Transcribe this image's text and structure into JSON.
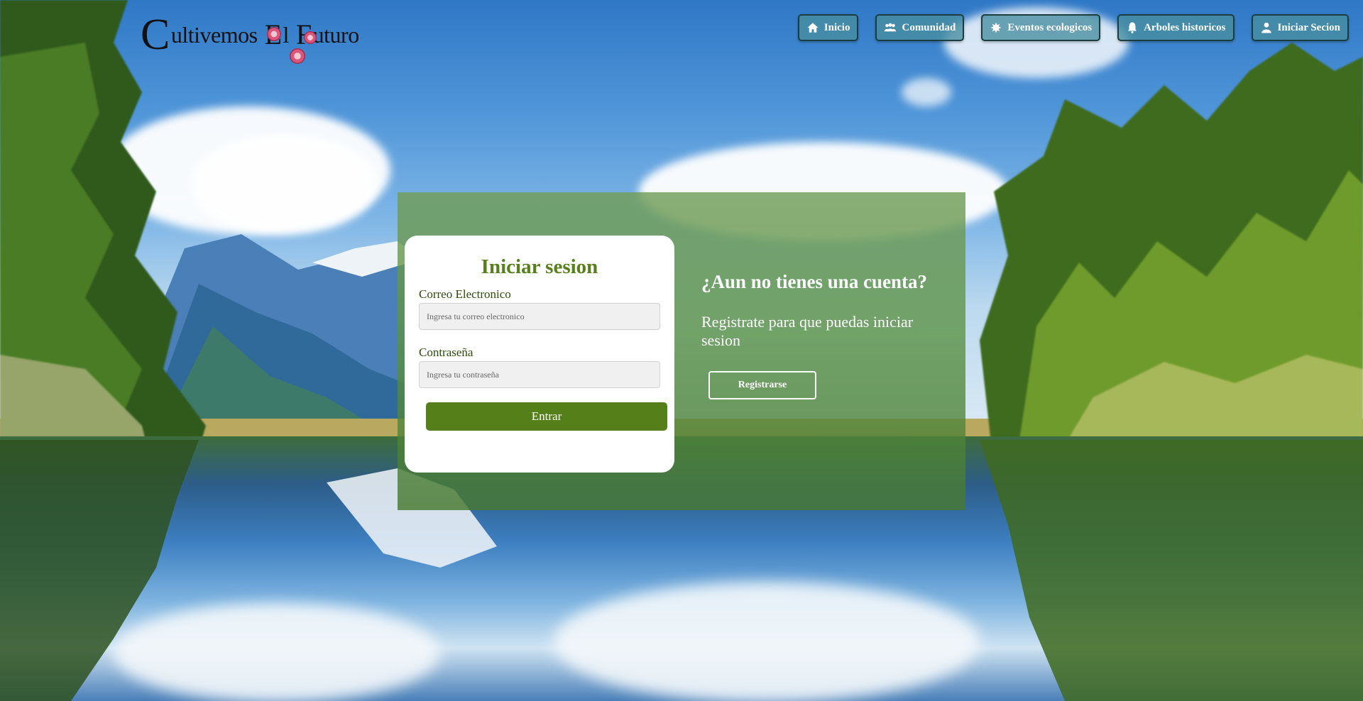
{
  "header": {
    "logo": {
      "c": "C",
      "ultivemos": "ultivemos",
      "e": "E",
      "l": "l",
      "f": "F",
      "uturo": "uturo"
    },
    "nav": [
      {
        "label": "Inicio",
        "icon": "home-icon"
      },
      {
        "label": "Comunidad",
        "icon": "users-icon"
      },
      {
        "label": "Eventos ecologicos",
        "icon": "leaf-icon"
      },
      {
        "label": "Arboles historicos",
        "icon": "bell-icon"
      },
      {
        "label": "Iniciar Secion",
        "icon": "user-icon"
      }
    ]
  },
  "login": {
    "title": "Iniciar sesion",
    "email_label": "Correo Electronico",
    "email_placeholder": "Ingresa tu correo electronico",
    "password_label": "Contraseña",
    "password_placeholder": "Ingresa tu contraseña",
    "submit_label": "Entrar"
  },
  "register": {
    "heading": "¿Aun no tienes una cuenta?",
    "text": "Registrate para que puedas iniciar sesion",
    "button_label": "Registrarse"
  },
  "colors": {
    "brand_green": "#577f1a",
    "nav_button": "#488ea0"
  }
}
